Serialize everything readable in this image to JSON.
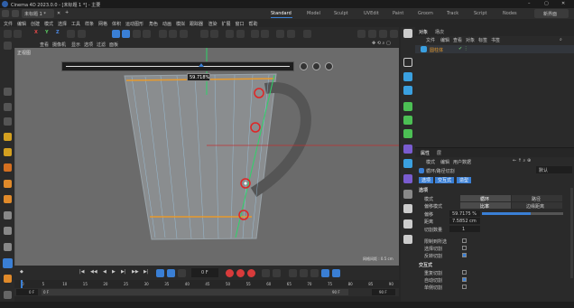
{
  "titlebar": {
    "app_title": "Cinema 4D 2023.0.0 - [未标题 1 *] - 主要",
    "file_tab": "未标题 1 *",
    "layout_tabs": [
      "Standard",
      "Model",
      "Sculpt",
      "UVEdit",
      "Paint",
      "Groom",
      "Track",
      "Script",
      "Nodes"
    ],
    "active_layout": "Standard",
    "new_layout": "新界面"
  },
  "menubar": {
    "items": [
      "文件",
      "编辑",
      "创建",
      "模式",
      "选择",
      "工具",
      "样条",
      "网格",
      "体积",
      "运动图形",
      "角色",
      "动画",
      "模拟",
      "跟踪器",
      "渲染",
      "扩展",
      "窗口",
      "帮助"
    ]
  },
  "mode_toolbar": {
    "axes": [
      "X",
      "Y",
      "Z"
    ]
  },
  "viewport": {
    "menu": [
      "查看",
      "摄像机",
      "显示",
      "选项",
      "过滤",
      "面板"
    ],
    "camera_label": "正视图",
    "slider_value": "59.718%",
    "grid_info": "网格间距 : 0.5 cm"
  },
  "objects_panel": {
    "tabs": [
      "对象",
      "场次"
    ],
    "menu": [
      "文件",
      "编辑",
      "查看",
      "对象",
      "标签",
      "书签"
    ],
    "objects": [
      {
        "name": "圆柱体"
      }
    ]
  },
  "attributes_panel": {
    "tabs": [
      "属性",
      "层"
    ],
    "menu": [
      "模式",
      "编辑",
      "用户数据"
    ],
    "mode_select": "默认",
    "title": "循环/路径切割",
    "subtabs": [
      "选项",
      "交互式",
      "造型"
    ],
    "section_options": "选项",
    "mode_label": "模式",
    "mode_values": [
      "循环",
      "路径"
    ],
    "offset_mode_label": "偏移模式",
    "offset_mode_values": [
      "比率",
      "边缘距离"
    ],
    "offset_label": "偏移",
    "offset_value": "59.7175 %",
    "offset_fill": 0.597,
    "distance_label": "距离",
    "distance_value": "7.5852 cm",
    "cut_count_label": "切割数量",
    "cut_count_value": "1",
    "checkboxes": [
      {
        "label": "限制到所选",
        "checked": false
      },
      {
        "label": "选择切割",
        "checked": false
      },
      {
        "label": "反转切割",
        "checked": true
      }
    ],
    "section_interactive": "交互式",
    "interactive_checkboxes": [
      {
        "label": "重复切割",
        "checked": false
      },
      {
        "label": "自动切割",
        "checked": true
      },
      {
        "label": "单侧切割",
        "checked": false
      }
    ]
  },
  "timeline": {
    "ticks": [
      "0",
      "5",
      "10",
      "15",
      "20",
      "25",
      "30",
      "35",
      "40",
      "45",
      "50",
      "55",
      "60",
      "65",
      "70",
      "75",
      "80",
      "85",
      "90"
    ],
    "current_frame": "0 F",
    "start_frame": "0 F",
    "start_field": "0 F",
    "end_frame": "90 F",
    "end_field": "90 F"
  },
  "colors": {
    "accent_blue": "#3a7fd5",
    "highlight_orange": "#e89a2c",
    "marker_red": "#e02525",
    "guide_green": "#2ed36a",
    "record_red": "#d83b3b"
  }
}
